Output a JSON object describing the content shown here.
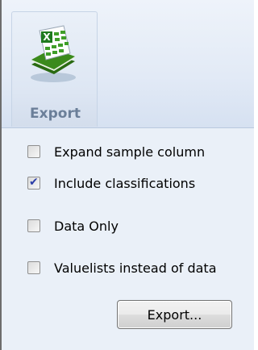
{
  "ribbon": {
    "export_label": "Export",
    "icon": "excel-export-icon"
  },
  "options": [
    {
      "label": "Expand sample column",
      "checked": false
    },
    {
      "label": "Include classifications",
      "checked": true
    },
    {
      "label": "Data Only",
      "checked": false
    },
    {
      "label": "Valuelists instead of data",
      "checked": false
    }
  ],
  "export_button": {
    "label": "Export..."
  },
  "colors": {
    "ribbon_bg": "#e2eaf6",
    "content_bg": "#eaf0f8",
    "label_accent": "#6b7f99",
    "checkmark": "#2b3ea8"
  }
}
